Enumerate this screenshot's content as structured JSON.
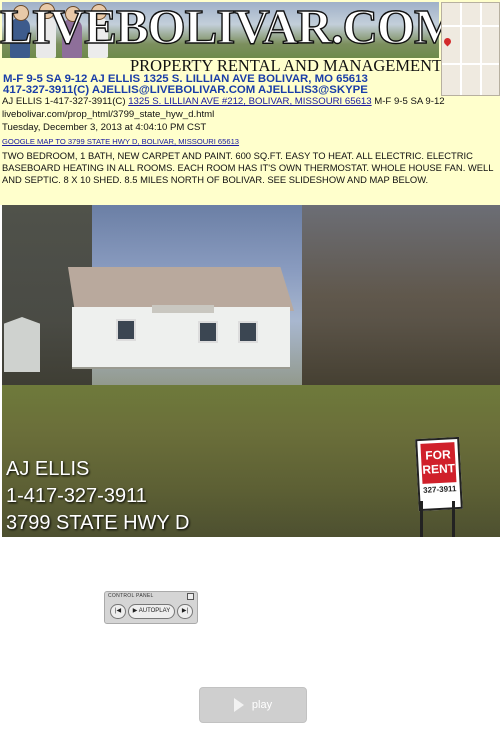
{
  "header": {
    "logo_text": "LIVEBOLIVAR.COM",
    "tagline": "PROPERTY RENTAL AND MANAGEMENT",
    "line1": "M-F 9-5  SA 9-12  AJ ELLIS  1325 S. LILLIAN AVE BOLIVAR, MO 65613",
    "line2": "417-327-3911(C)   AJELLIS@LIVEBOLIVAR.COM   AJELLLIS3@SKYPE"
  },
  "info": {
    "contact_prefix": "AJ ELLIS  1-417-327-3911(C)",
    "address_link": "1325 S. LILLIAN AVE #212, BOLIVAR, MISSOURI 65613",
    "hours": "M-F 9-5 SA 9-12",
    "url": "livebolivar.com/prop_html/3799_state_hyw_d.html",
    "datetime": "Tuesday, December 3, 2013 at 4:04:10 PM CST",
    "map_link": "GOOGLE MAP TO 3799 STATE HWY D, BOLIVAR, MISSOURI 65613",
    "description": "TWO BEDROOM, 1 BATH, NEW CARPET AND PAINT.  600 SQ.FT.  EASY TO HEAT.  ALL ELECTRIC.  ELECTRIC BASEBOARD HEATING IN ALL ROOMS.  EACH ROOM HAS IT'S OWN THERMOSTAT.  WHOLE HOUSE FAN.  WELL AND SEPTIC.  8 X 10 SHED.  8.5 MILES NORTH OF BOLIVAR.  SEE SLIDESHOW AND MAP BELOW."
  },
  "photo": {
    "overlay_name": "AJ ELLIS",
    "overlay_phone": "1-417-327-3911",
    "overlay_address": "3799 STATE HWY D",
    "sign_top": "FOR RENT",
    "sign_phone": "327-3911"
  },
  "control_panel": {
    "title": "CONTROL PANEL",
    "prev_icon": "skip-back-icon",
    "autoplay_label": "AUTOPLAY",
    "next_icon": "skip-forward-icon"
  },
  "play": {
    "label": "play"
  },
  "colors": {
    "banner_bg": "#ffffcc",
    "info_text_blue": "#1a3ea8",
    "link": "#1a1aa0"
  }
}
